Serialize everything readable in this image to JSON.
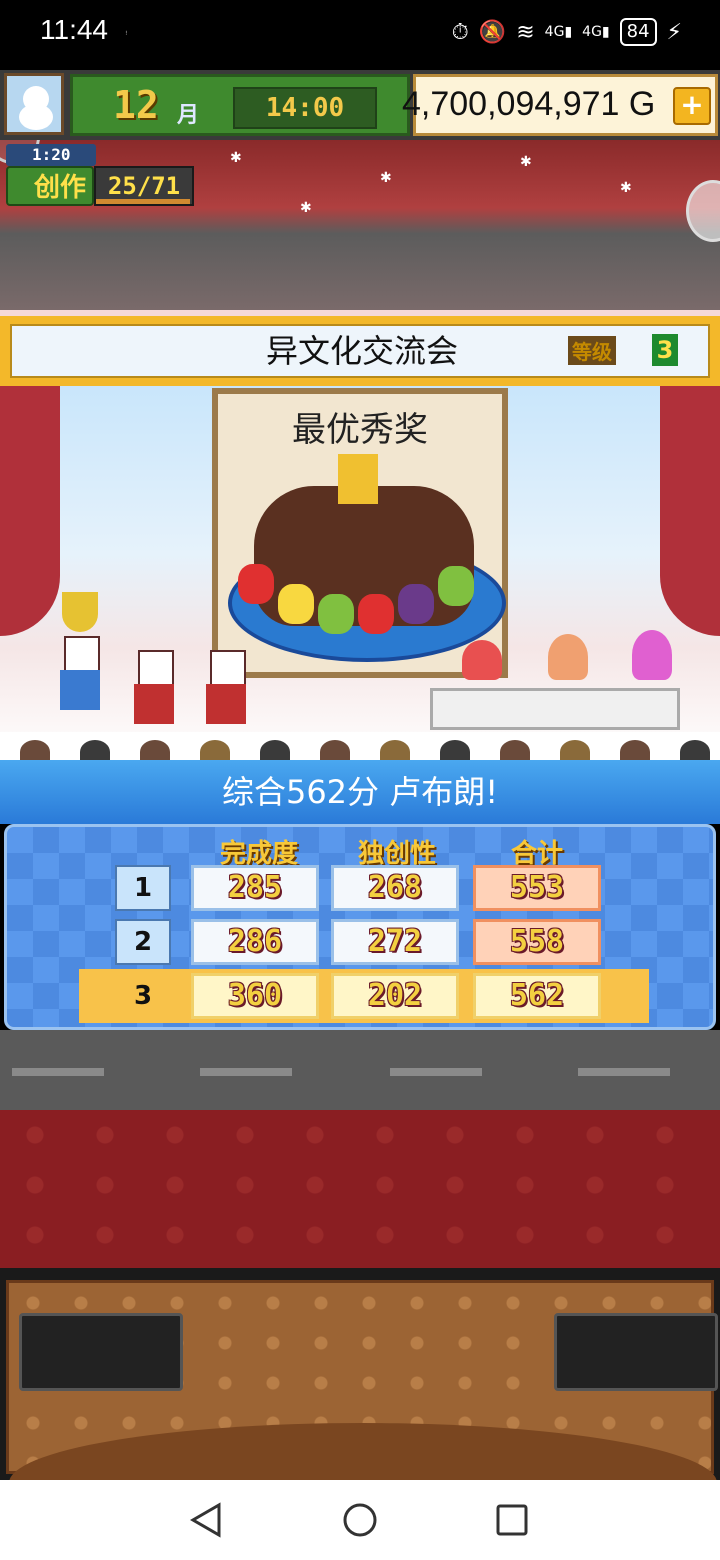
{
  "status_bar": {
    "time": "11:44",
    "small_indicator": "ꜝ",
    "network1": "4G",
    "network2": "4G",
    "battery": "84"
  },
  "top_bar": {
    "month_number": "12",
    "month_label": "月",
    "clock": "14:00",
    "money": "4,700,094,971 G",
    "add_money_symbol": "+"
  },
  "progress": {
    "timer": "1:20",
    "label": "创作",
    "count": "25/71"
  },
  "event": {
    "title": "异文化交流会",
    "level_label": "等级",
    "level": "3"
  },
  "award": {
    "title": "最优秀奖"
  },
  "score": {
    "announcement": "综合562分 卢布朗!",
    "columns": [
      "完成度",
      "独创性",
      "合计"
    ],
    "rows": [
      {
        "rank": "1",
        "completion": "285",
        "originality": "268",
        "total": "553"
      },
      {
        "rank": "2",
        "completion": "286",
        "originality": "272",
        "total": "558"
      },
      {
        "rank": "3",
        "completion": "360",
        "originality": "202",
        "total": "562"
      }
    ]
  },
  "colors": {
    "accent_blue": "#2a7ad8",
    "gold": "#f3c94a",
    "carpet": "#8a1e22"
  }
}
